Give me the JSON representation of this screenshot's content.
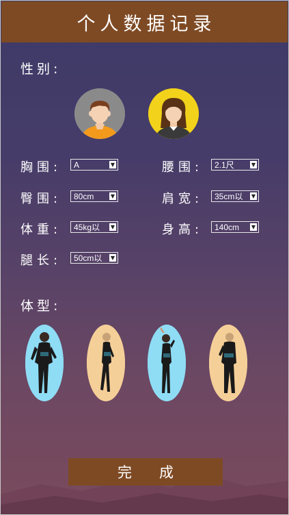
{
  "header": {
    "title": "个人数据记录"
  },
  "gender": {
    "label": "性别:",
    "options": [
      {
        "icon": "male-avatar-icon",
        "bg": "#8a8a8a"
      },
      {
        "icon": "female-avatar-icon",
        "bg": "#f2d21a"
      }
    ]
  },
  "fields": {
    "chest": {
      "label": "胸围:",
      "value": "A"
    },
    "waist": {
      "label": "腰围:",
      "value": "2.1尺"
    },
    "hip": {
      "label": "臀围:",
      "value": "80cm"
    },
    "shoulder": {
      "label": "肩宽:",
      "value": "35cm以"
    },
    "weight": {
      "label": "体重:",
      "value": "45kg以"
    },
    "height": {
      "label": "身高:",
      "value": "140cm"
    },
    "leg": {
      "label": "腿长:",
      "value": "50cm以"
    }
  },
  "body_type": {
    "label": "体型:",
    "options": [
      {
        "bg": "#8fdcf5"
      },
      {
        "bg": "#f5cf98"
      },
      {
        "bg": "#8fdcf5"
      },
      {
        "bg": "#f5cf98"
      }
    ]
  },
  "done_button": {
    "label": "完成"
  },
  "colors": {
    "header_bg": "#7e4a24",
    "button_bg": "#7e4a24"
  }
}
